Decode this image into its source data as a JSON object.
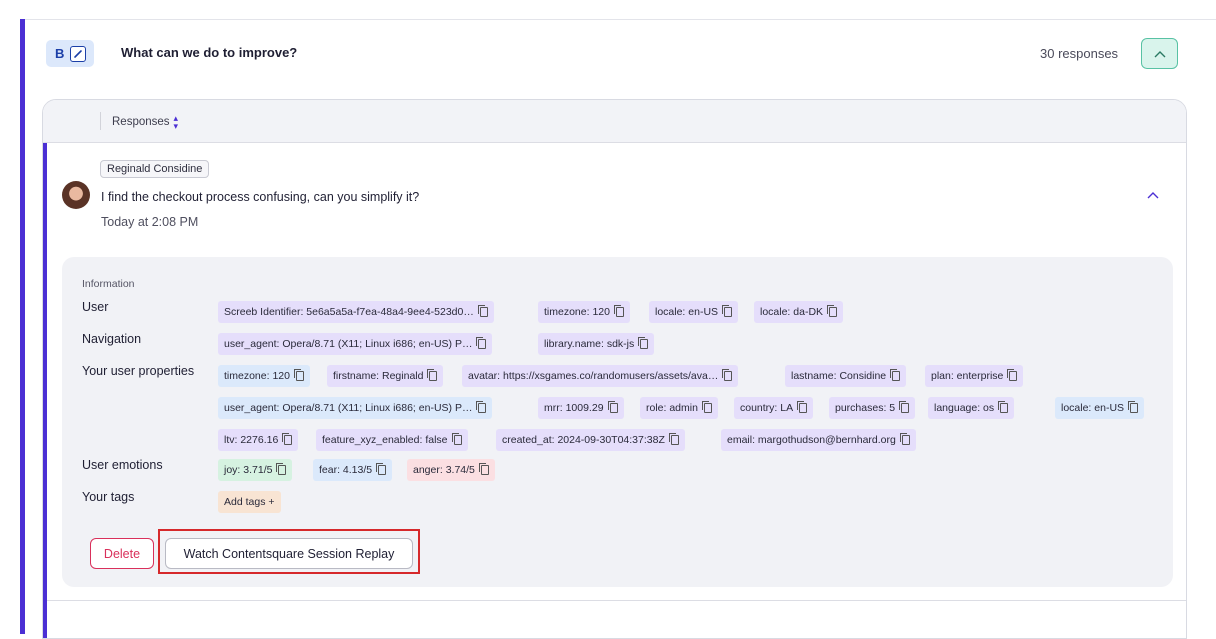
{
  "question": {
    "type_letter": "B",
    "title": "What can we do to improve?",
    "response_count": "30 responses"
  },
  "responses_panel": {
    "column_label": "Responses"
  },
  "response": {
    "author": "Reginald Considine",
    "text": "I find the checkout process confusing, can you simplify it?",
    "time": "Today at 2:08 PM"
  },
  "info": {
    "title": "Information",
    "labels": {
      "user": "User",
      "navigation": "Navigation",
      "user_properties": "Your user properties",
      "emotions": "User emotions",
      "tags": "Your tags"
    },
    "user_chips": [
      "Screeb Identifier: 5e6a5a5a-f7ea-48a4-9ee4-523d0…",
      "timezone: 120",
      "locale: en-US",
      "locale: da-DK"
    ],
    "navigation_chips": [
      "user_agent: Opera/8.71 (X11; Linux i686; en-US) P…",
      "library.name: sdk-js"
    ],
    "property_chips_row1": [
      "timezone: 120",
      "firstname: Reginald",
      "avatar: https://xsgames.co/randomusers/assets/ava…",
      "lastname: Considine",
      "plan: enterprise"
    ],
    "property_chips_row2": [
      "user_agent: Opera/8.71 (X11; Linux i686; en-US) P…",
      "mrr: 1009.29",
      "role: admin",
      "country: LA",
      "purchases: 5",
      "language: os",
      "locale: en-US"
    ],
    "property_chips_row3": [
      "ltv: 2276.16",
      "feature_xyz_enabled: false",
      "created_at: 2024-09-30T04:37:38Z",
      "email: margothudson@bernhard.org"
    ],
    "emotion_chips": [
      "joy: 3.71/5",
      "fear: 4.13/5",
      "anger: 3.74/5"
    ],
    "add_tags_label": "Add tags +"
  },
  "actions": {
    "delete_label": "Delete",
    "replay_label": "Watch Contentsquare Session Replay"
  },
  "colors": {
    "accent": "#4b2fd4",
    "delete": "#d9305b",
    "highlight": "#d6292b"
  }
}
